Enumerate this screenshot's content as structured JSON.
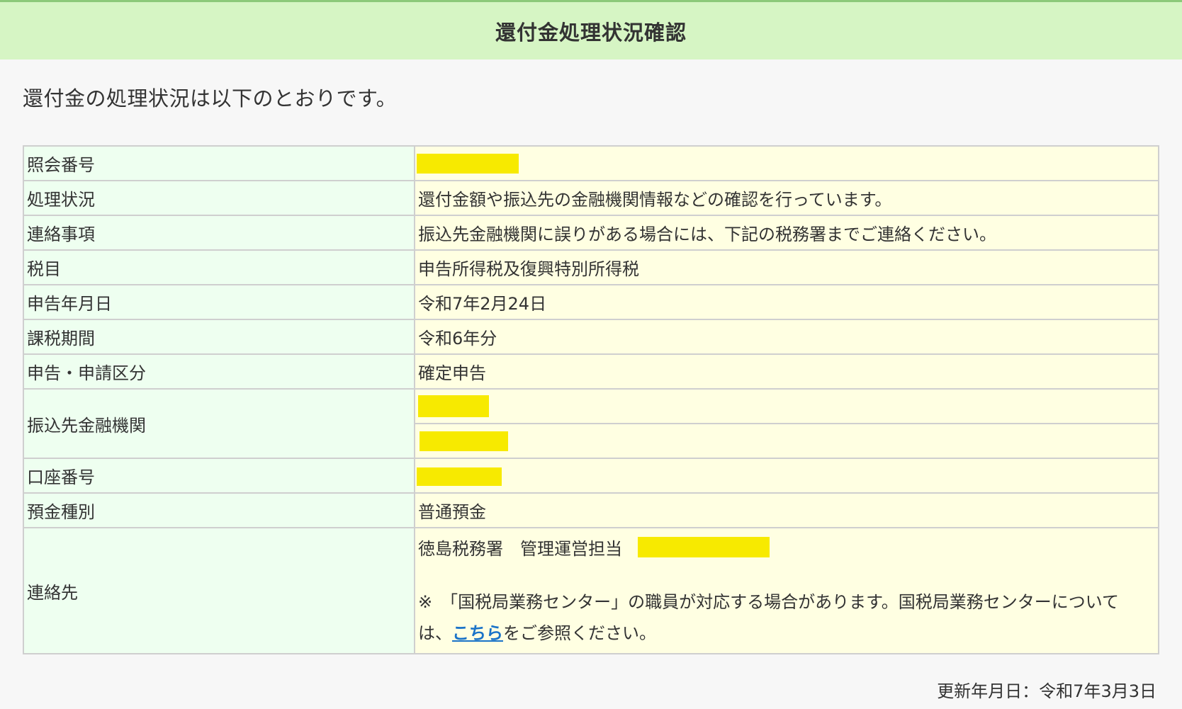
{
  "header": {
    "title": "還付金処理状況確認"
  },
  "intro": "還付金の処理状況は以下のとおりです。",
  "rows": {
    "inquiry_number": {
      "label": "照会番号",
      "value": ""
    },
    "status": {
      "label": "処理状況",
      "value": "還付金額や振込先の金融機関情報などの確認を行っています。"
    },
    "notice": {
      "label": "連絡事項",
      "value": "振込先金融機関に誤りがある場合には、下記の税務署までご連絡ください。"
    },
    "tax_item": {
      "label": "税目",
      "value": "申告所得税及復興特別所得税"
    },
    "filing_date": {
      "label": "申告年月日",
      "value": "令和7年2月24日"
    },
    "tax_period": {
      "label": "課税期間",
      "value": "令和6年分"
    },
    "filing_type": {
      "label": "申告・申請区分",
      "value": "確定申告"
    },
    "bank": {
      "label": "振込先金融機関",
      "value_1": "",
      "value_2": ""
    },
    "account_number": {
      "label": "口座番号",
      "value": ""
    },
    "deposit_type": {
      "label": "預金種別",
      "value": "普通預金"
    },
    "contact": {
      "label": "連絡先",
      "office": "徳島税務署　管理運営担当",
      "note_prefix": "※　「国税局業務センター」の職員が対応する場合があります。国税局業務センターについては、",
      "link_text": "こちら",
      "note_suffix": "をご参照ください。"
    }
  },
  "footer": {
    "updated": "更新年月日：令和7年3月3日"
  },
  "colors": {
    "header_bg": "#d6f5c4",
    "label_bg": "#eefff0",
    "value_bg": "#ffffe2",
    "redaction": "#f7ea00",
    "link": "#1a73c8"
  }
}
